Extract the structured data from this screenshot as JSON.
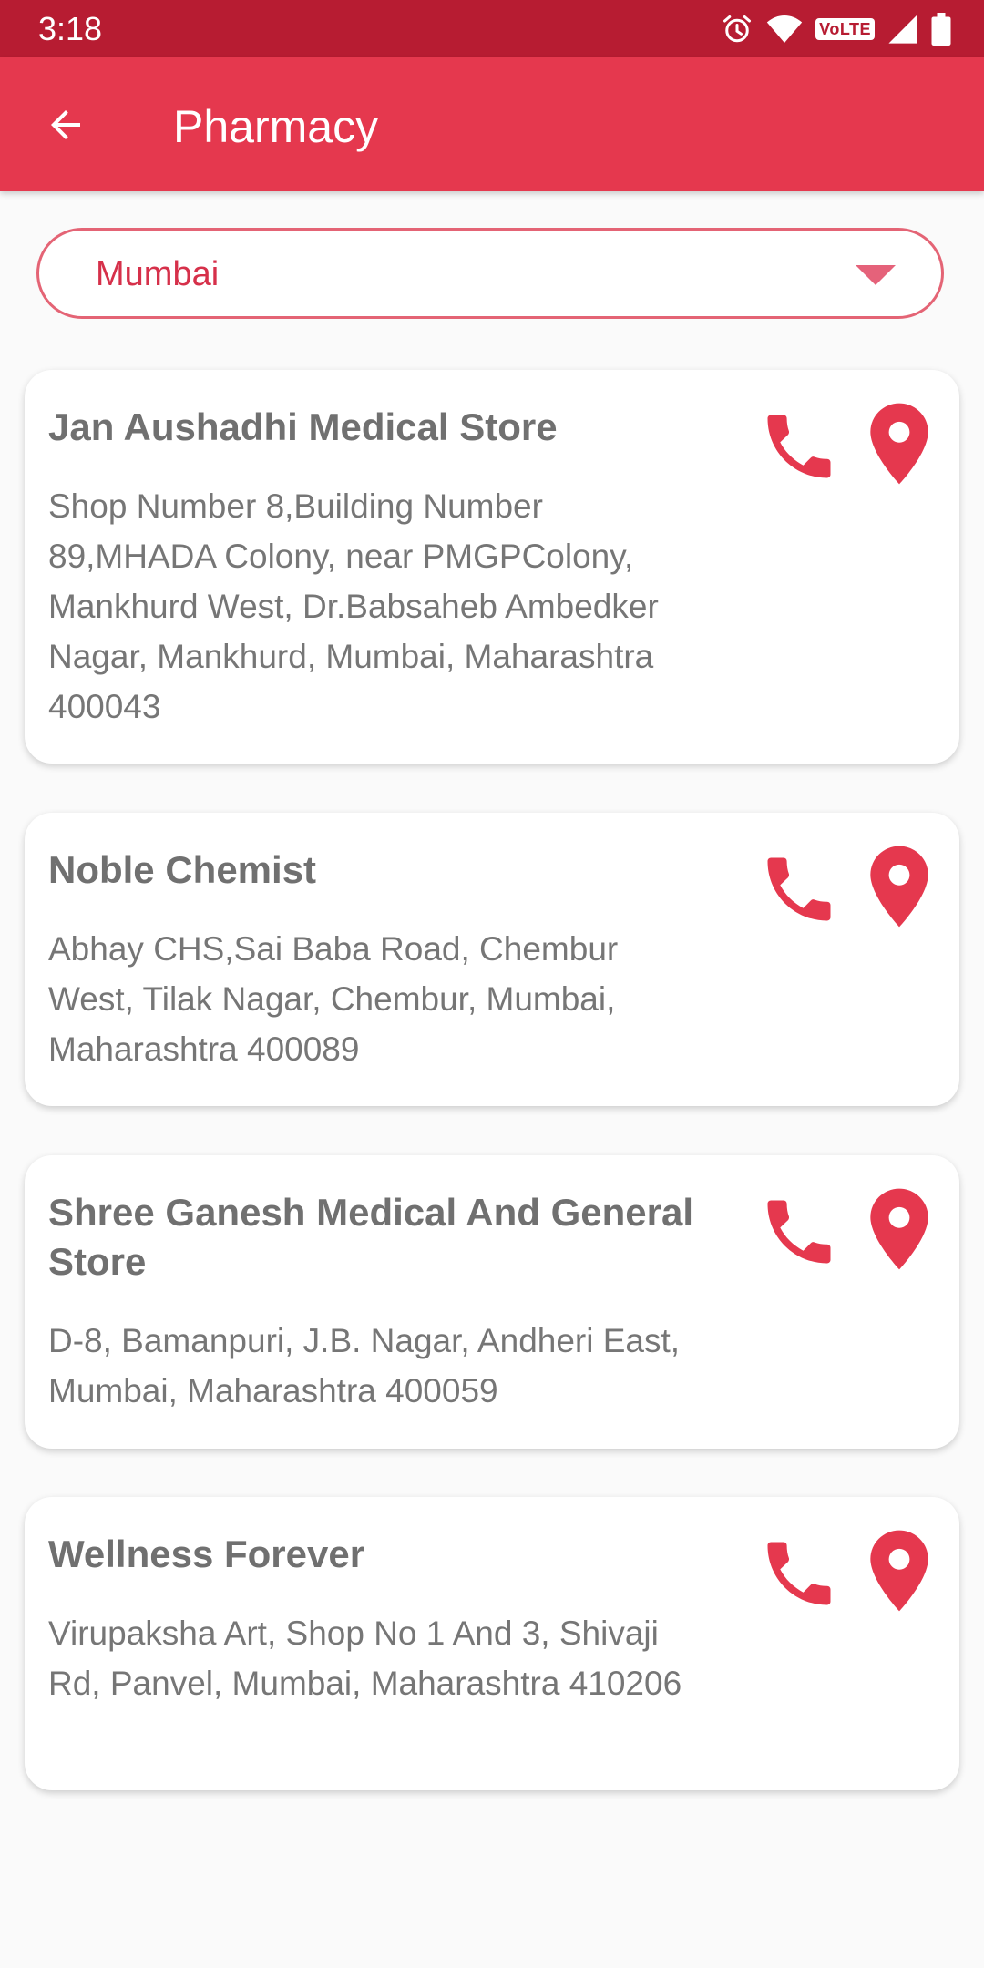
{
  "status_bar": {
    "time": "3:18",
    "icons": [
      "alarm-icon",
      "wifi-icon",
      "volte-badge",
      "signal-icon",
      "battery-icon"
    ],
    "volte_label": "VoLTE"
  },
  "app_bar": {
    "title": "Pharmacy",
    "back_icon": "arrow-left-icon"
  },
  "city_select": {
    "selected": "Mumbai"
  },
  "stores": [
    {
      "name": "Jan Aushadhi Medical Store",
      "address": "Shop Number 8,Building Number 89,MHADA Colony, near PMGPColony, Mankhurd West, Dr.Babsaheb Ambedker Nagar, Mankhurd, Mumbai, Maharashtra 400043"
    },
    {
      "name": "Noble Chemist",
      "address": "Abhay CHS,Sai Baba Road, Chembur West, Tilak Nagar, Chembur, Mumbai, Maharashtra 400089"
    },
    {
      "name": "Shree Ganesh Medical And General Store",
      "address": "D-8, Bamanpuri, J.B. Nagar, Andheri East, Mumbai, Maharashtra 400059"
    },
    {
      "name": "Wellness Forever",
      "address": "Virupaksha Art, Shop No 1 And 3, Shivaji Rd, Panvel, Mumbai, Maharashtra 410206"
    }
  ],
  "colors": {
    "status_bar": "#b71c32",
    "app_bar": "#e5384e",
    "accent": "#e5384e"
  }
}
